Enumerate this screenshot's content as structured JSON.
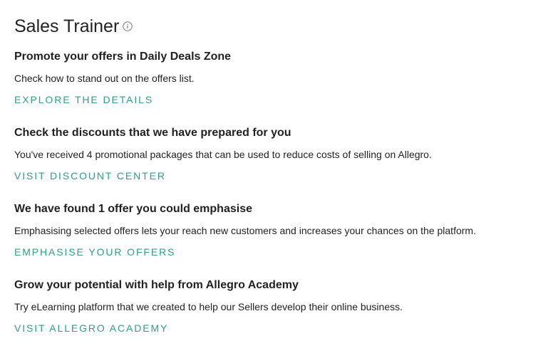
{
  "header": {
    "title": "Sales Trainer",
    "info_icon": "info-circle-icon"
  },
  "colors": {
    "link": "#2e9d8a",
    "text": "#222222",
    "icon": "#777777"
  },
  "sections": [
    {
      "heading": "Promote your offers in Daily Deals Zone",
      "description": "Check how to stand out on the offers list.",
      "link": "EXPLORE THE DETAILS"
    },
    {
      "heading": "Check the discounts that we have prepared for you",
      "description": "You've received 4 promotional packages that can be used to reduce costs of selling on Allegro.",
      "link": "VISIT DISCOUNT CENTER"
    },
    {
      "heading": "We have found 1 offer you could emphasise",
      "description": "Emphasising selected offers lets your reach new customers and increases your chances on the platform.",
      "link": "EMPHASISE YOUR OFFERS"
    },
    {
      "heading": "Grow your potential with help from Allegro Academy",
      "description": "Try eLearning platform that we created to help our Sellers develop their online business.",
      "link": "VISIT ALLEGRO ACADEMY"
    }
  ]
}
